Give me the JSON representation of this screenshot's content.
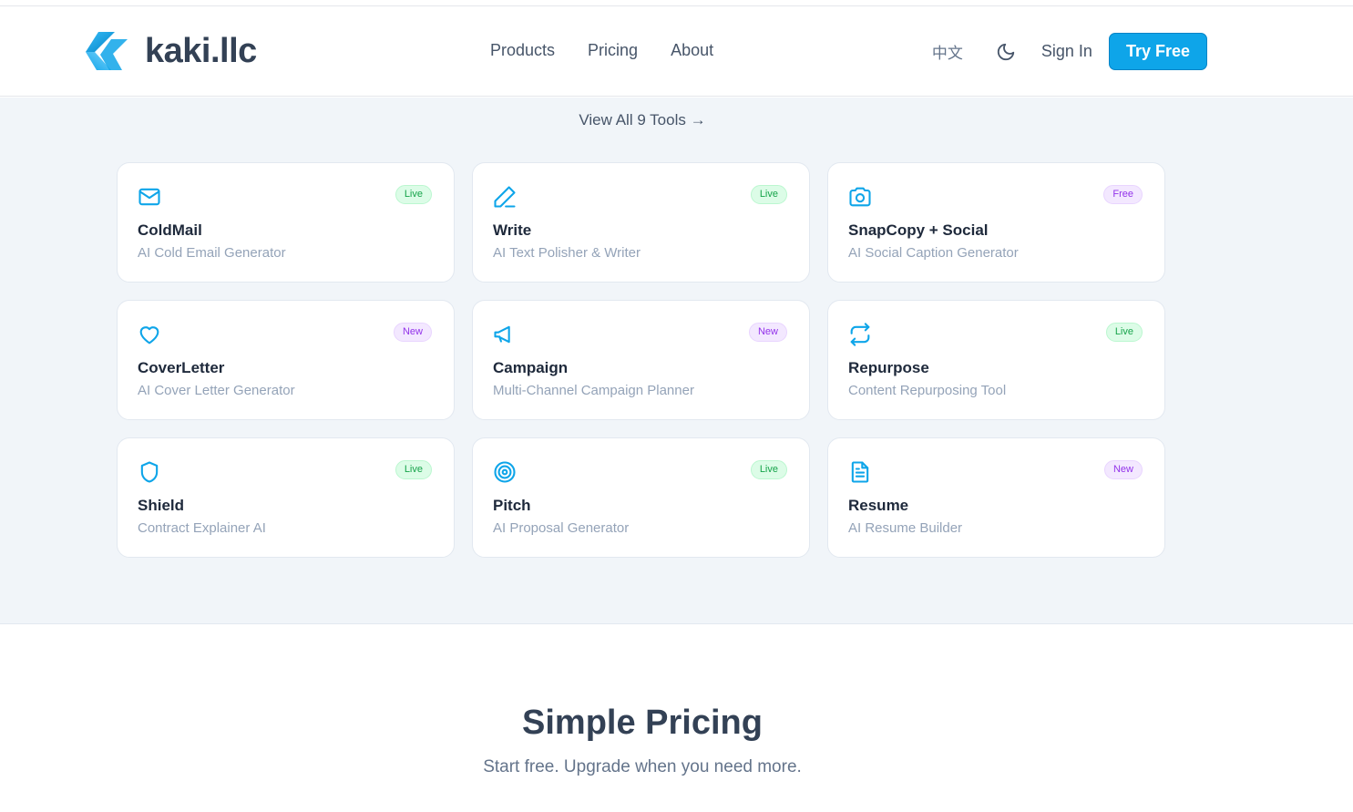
{
  "brand": {
    "name": "kaki.llc",
    "accent": "#0ea5e9"
  },
  "nav": [
    {
      "label": "Products"
    },
    {
      "label": "Pricing"
    },
    {
      "label": "About"
    }
  ],
  "header": {
    "language": "中文",
    "theme_icon": "moon-icon",
    "sign_in": "Sign In",
    "try_free": "Try Free"
  },
  "tools": {
    "view_all": "View All 9 Tools →",
    "cards": [
      {
        "icon": "mail-icon",
        "title": "ColdMail",
        "subtitle": "AI Cold Email Generator",
        "badge": "Live"
      },
      {
        "icon": "pen-icon",
        "title": "Write",
        "subtitle": "AI Text Polisher & Writer",
        "badge": "Live"
      },
      {
        "icon": "camera-icon",
        "title": "SnapCopy + Social",
        "subtitle": "AI Social Caption Generator",
        "badge": "Free"
      },
      {
        "icon": "heart-icon",
        "title": "CoverLetter",
        "subtitle": "AI Cover Letter Generator",
        "badge": "New"
      },
      {
        "icon": "megaphone-icon",
        "title": "Campaign",
        "subtitle": "Multi-Channel Campaign Planner",
        "badge": "New"
      },
      {
        "icon": "repeat-icon",
        "title": "Repurpose",
        "subtitle": "Content Repurposing Tool",
        "badge": "Live"
      },
      {
        "icon": "shield-icon",
        "title": "Shield",
        "subtitle": "Contract Explainer AI",
        "badge": "Live"
      },
      {
        "icon": "target-icon",
        "title": "Pitch",
        "subtitle": "AI Proposal Generator",
        "badge": "Live"
      },
      {
        "icon": "document-icon",
        "title": "Resume",
        "subtitle": "AI Resume Builder",
        "badge": "New"
      }
    ]
  },
  "pricing": {
    "title": "Simple Pricing",
    "subtitle": "Start free. Upgrade when you need more."
  }
}
